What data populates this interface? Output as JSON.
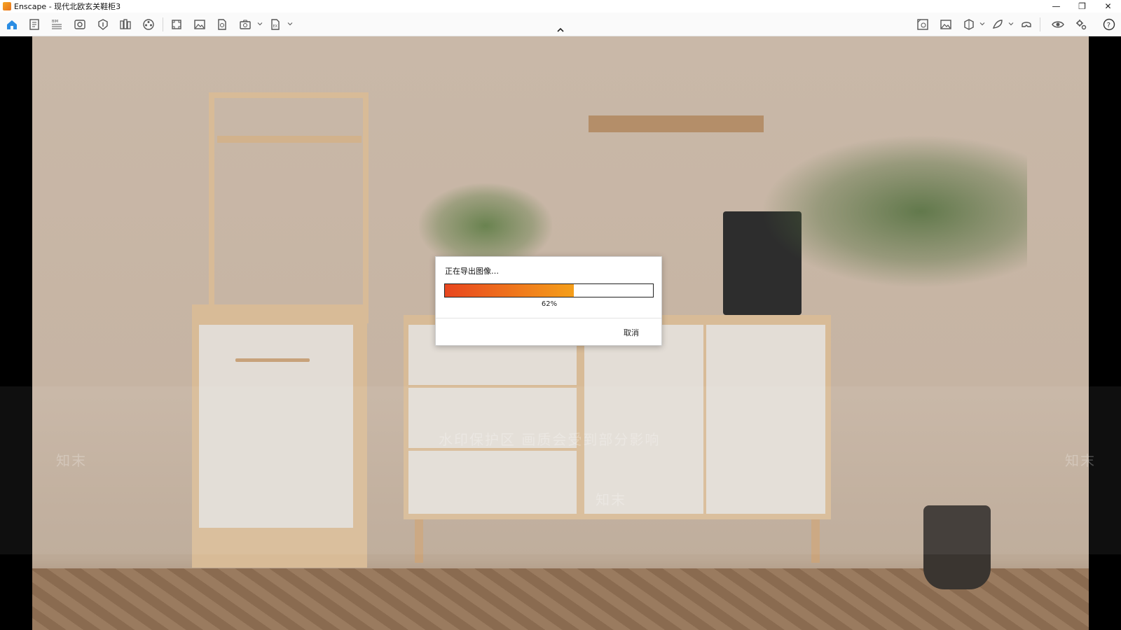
{
  "window": {
    "title": "Enscape - 现代北欧玄关鞋柜3",
    "controls": {
      "minimize": "—",
      "restore": "❐",
      "close": "✕"
    }
  },
  "toolbar": {
    "left_buttons": [
      {
        "name": "home-icon",
        "active": true
      },
      {
        "name": "document-icon"
      },
      {
        "name": "bim-icon",
        "label": "BIM"
      },
      {
        "name": "view-icon"
      },
      {
        "name": "asset-icon"
      },
      {
        "name": "library-icon"
      },
      {
        "name": "video-editor-icon"
      },
      {
        "name": "batch-render-icon"
      },
      {
        "name": "screenshot-icon"
      },
      {
        "name": "panorama-icon"
      },
      {
        "name": "export-standalone-icon"
      },
      {
        "name": "export-file-icon"
      }
    ],
    "right_buttons": [
      {
        "name": "material-editor-icon"
      },
      {
        "name": "image-settings-icon"
      },
      {
        "name": "section-icon"
      },
      {
        "name": "feedback-icon"
      },
      {
        "name": "vr-headset-icon"
      },
      {
        "name": "visibility-icon"
      },
      {
        "name": "settings-icon"
      },
      {
        "name": "help-icon"
      }
    ],
    "accent_color": "#2b8de3"
  },
  "viewport": {
    "watermark": "水印保护区  画质会受到部分影响",
    "watermark_logo": "知末"
  },
  "export_dialog": {
    "title": "正在导出图像…",
    "progress_percent": 62,
    "progress_label": "62%",
    "cancel_label": "取消",
    "progress_colors": [
      "#e8461f",
      "#f59f1a"
    ]
  }
}
